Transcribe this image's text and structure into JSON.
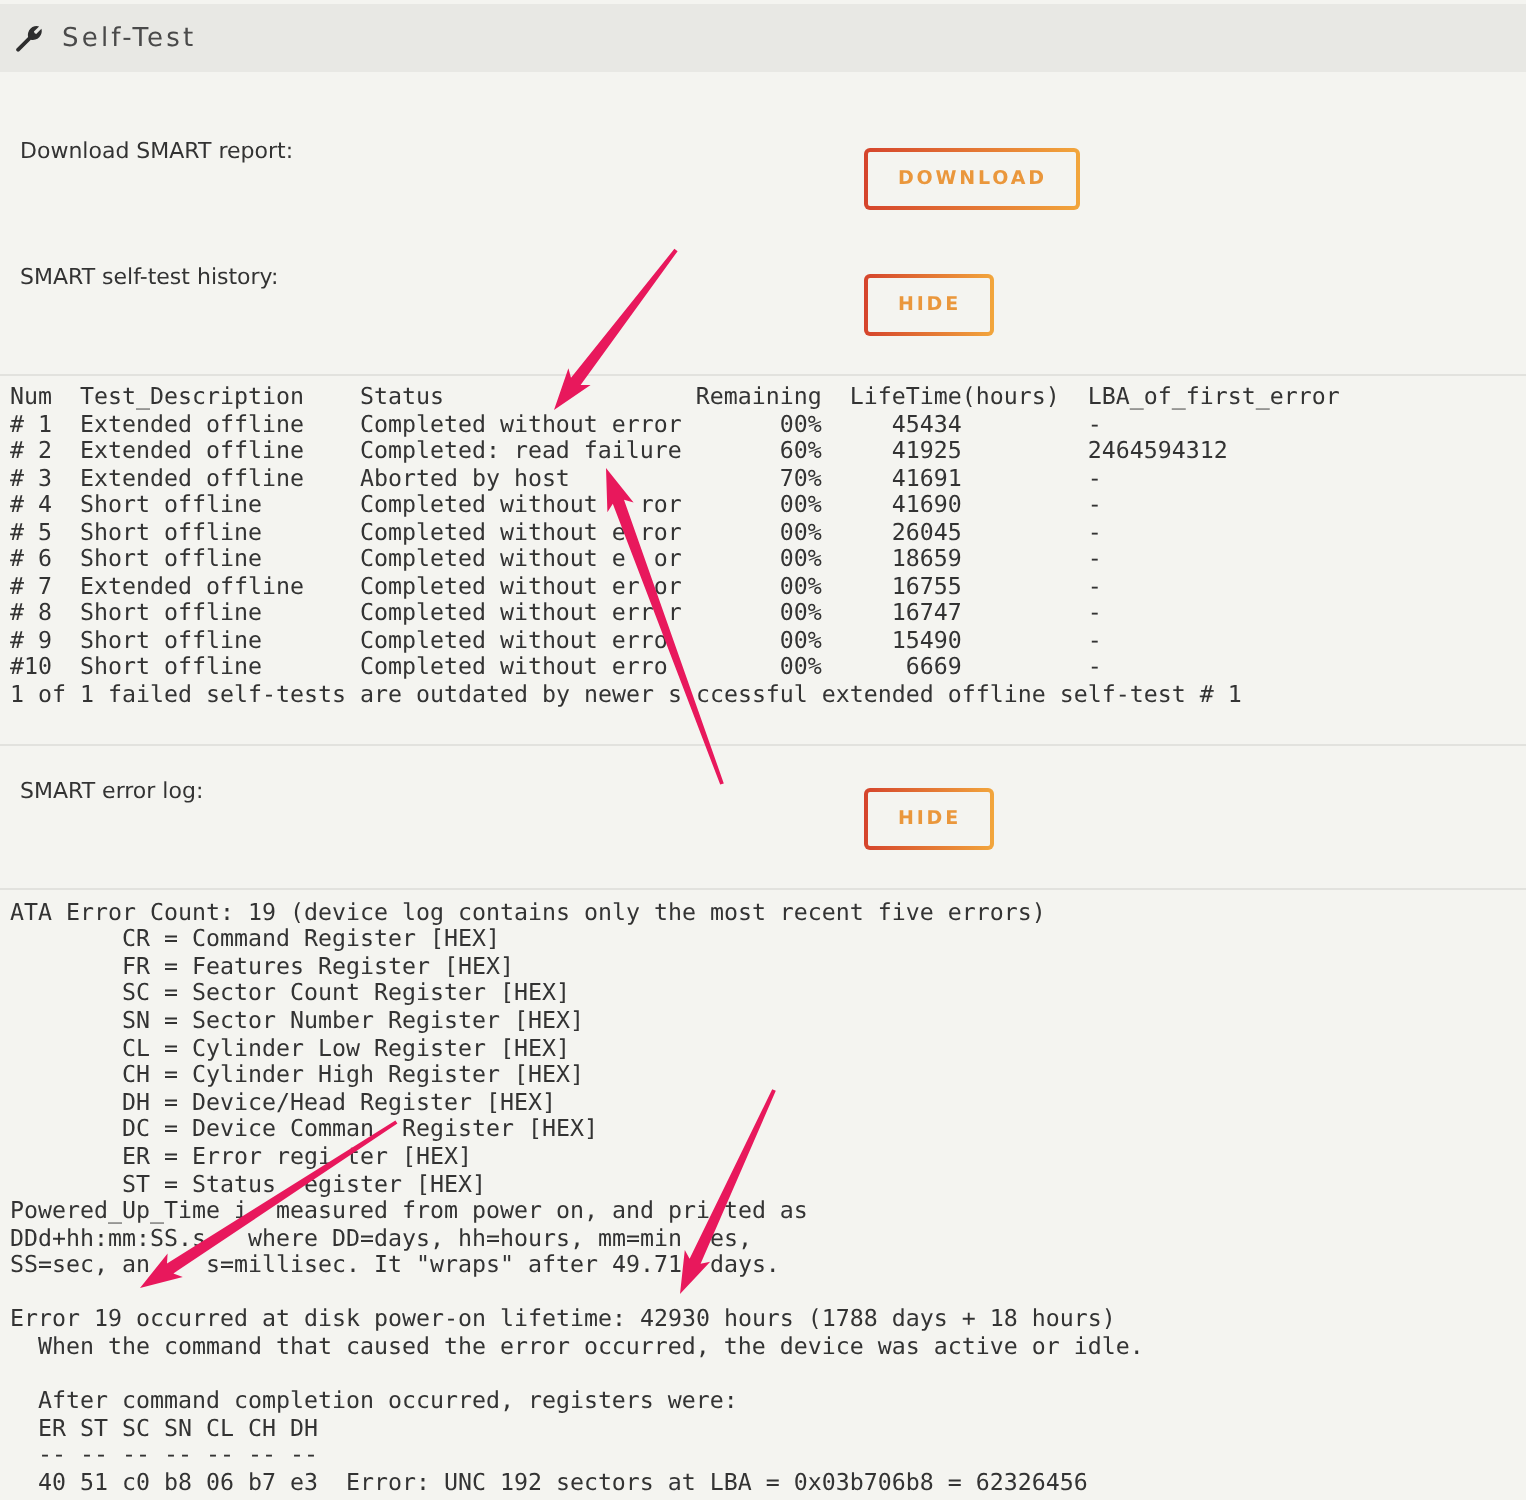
{
  "panel": {
    "title": "Self-Test"
  },
  "download": {
    "label": "Download SMART report:",
    "button": "DOWNLOAD"
  },
  "self_test_history": {
    "label": "SMART self-test history:",
    "button": "HIDE",
    "table": {
      "columns": [
        "Num",
        "Test_Description",
        "Status",
        "Remaining",
        "LifeTime(hours)",
        "LBA_of_first_error"
      ],
      "rows": [
        [
          "# 1",
          "Extended offline",
          "Completed without error",
          "00%",
          "45434",
          "-"
        ],
        [
          "# 2",
          "Extended offline",
          "Completed: read failure",
          "60%",
          "41925",
          "2464594312"
        ],
        [
          "# 3",
          "Extended offline",
          "Aborted by host",
          "70%",
          "41691",
          "-"
        ],
        [
          "# 4",
          "Short offline",
          "Completed without   ror",
          "00%",
          "41690",
          "-"
        ],
        [
          "# 5",
          "Short offline",
          "Completed without e ror",
          "00%",
          "26045",
          "-"
        ],
        [
          "# 6",
          "Short offline",
          "Completed without e  or",
          "00%",
          "18659",
          "-"
        ],
        [
          "# 7",
          "Extended offline",
          "Completed without er or",
          "00%",
          "16755",
          "-"
        ],
        [
          "# 8",
          "Short offline",
          "Completed without err r",
          "00%",
          "16747",
          "-"
        ],
        [
          "# 9",
          "Short offline",
          "Completed without erro",
          "00%",
          "15490",
          "-"
        ],
        [
          "#10",
          "Short offline",
          "Completed without erro",
          "00%",
          "6669",
          "-"
        ]
      ],
      "footer": "1 of 1 failed self-tests are outdated by newer s ccessful extended offline self-test # 1"
    }
  },
  "error_log": {
    "label": "SMART error log:",
    "button": "HIDE",
    "summary": "ATA Error Count: 19 (device log contains only the most recent five errors)",
    "legend": [
      "CR = Command Register [HEX]",
      "FR = Features Register [HEX]",
      "SC = Sector Count Register [HEX]",
      "SN = Sector Number Register [HEX]",
      "CL = Cylinder Low Register [HEX]",
      "CH = Cylinder High Register [HEX]",
      "DH = Device/Head Register [HEX]",
      "DC = Device Comman  Register [HEX]",
      "ER = Error regi ter [HEX]",
      "ST = Status  egister [HEX]"
    ],
    "note": "Powered_Up_Time i  measured from power on, and pri ted as\nDDd+hh:mm:SS.s   where DD=days, hh=hours, mm=min  es,\nSS=sec, an    s=millisec. It \"wraps\" after 49.71  days.",
    "errors": [
      {
        "title": "Error 19 occurred at disk power-on lifetime: 42930 hours (1788 days + 18 hours)",
        "state": "When the command that caused the error occurred, the device was active or idle.",
        "registers": {
          "caption": "After command completion occurred, registers were:",
          "header": "ER ST SC SN CL CH DH",
          "rule": "-- -- -- -- -- -- --",
          "values": "40 51 c0 b8 06 b7 e3  Error: UNC 192 sectors at LBA = 0x03b706b8 = 62326456"
        }
      }
    ]
  }
}
